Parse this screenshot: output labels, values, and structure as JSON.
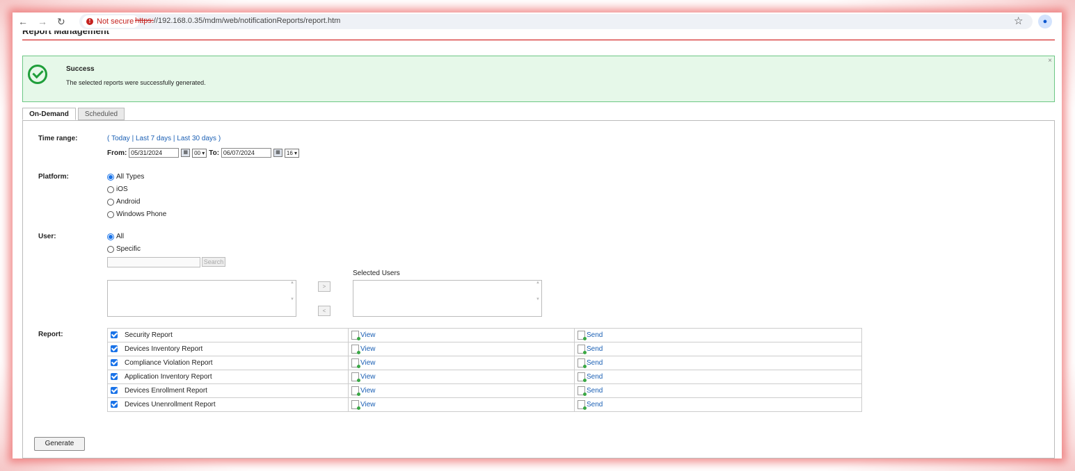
{
  "browser": {
    "security_label": "Not secure",
    "url_protocol": "https:",
    "url_rest": "//192.168.0.35/mdm/web/notificationReports/report.htm"
  },
  "page": {
    "title": "Report Management"
  },
  "alert": {
    "title": "Success",
    "message": "The selected reports were successfully generated.",
    "close": "×"
  },
  "tabs": [
    {
      "label": "On-Demand",
      "active": true
    },
    {
      "label": "Scheduled",
      "active": false
    }
  ],
  "time_range": {
    "label": "Time range:",
    "open": "(",
    "today": "Today",
    "sep1": "|",
    "last7": "Last 7 days",
    "sep2": "|",
    "last30": "Last 30 days",
    "close": ")",
    "from_label": "From:",
    "from_date": "05/31/2024",
    "from_hour": "00",
    "to_label": "To:",
    "to_date": "06/07/2024",
    "to_hour": "16"
  },
  "platform": {
    "label": "Platform:",
    "options": [
      "All Types",
      "iOS",
      "Android",
      "Windows Phone"
    ],
    "selected": "All Types"
  },
  "user": {
    "label": "User:",
    "options": [
      "All",
      "Specific"
    ],
    "selected": "All",
    "search_button": "Search",
    "selected_users_label": "Selected Users",
    "add": ">",
    "remove": "<"
  },
  "report": {
    "label": "Report:",
    "rows": [
      {
        "name": "Security Report",
        "view": "View",
        "send": "Send"
      },
      {
        "name": "Devices Inventory Report",
        "view": "View",
        "send": "Send"
      },
      {
        "name": "Compliance Violation Report",
        "view": "View",
        "send": "Send"
      },
      {
        "name": "Application Inventory Report",
        "view": "View",
        "send": "Send"
      },
      {
        "name": "Devices Enrollment Report",
        "view": "View",
        "send": "Send"
      },
      {
        "name": "Devices Unenrollment Report",
        "view": "View",
        "send": "Send"
      }
    ]
  },
  "generate_button": "Generate",
  "colors": {
    "success_bg": "#e6f8e9",
    "success_icon": "#1f9e3a",
    "link": "#1a5fb4",
    "title_rule": "#cc0000"
  }
}
